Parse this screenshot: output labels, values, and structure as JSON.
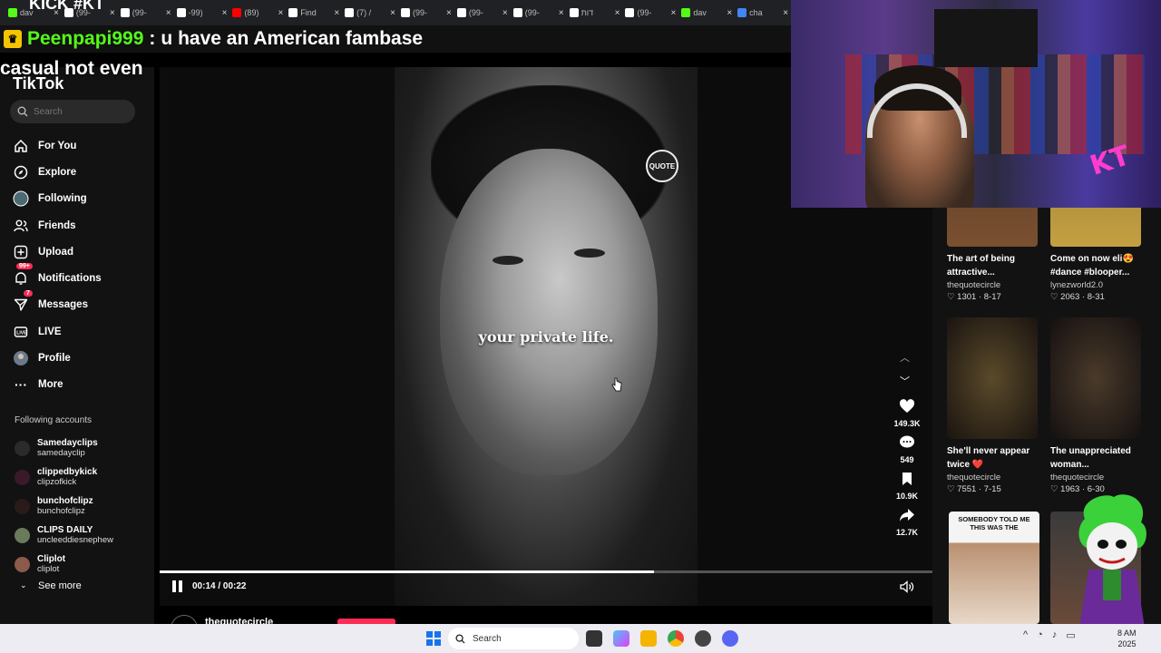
{
  "browser": {
    "tabs": [
      {
        "label": "dav",
        "icon": "kick-icon",
        "color": "#53fc18"
      },
      {
        "label": "(99-",
        "icon": "tiktok-icon",
        "color": "#ffffff"
      },
      {
        "label": "(99-",
        "icon": "tiktok-icon",
        "color": "#ffffff"
      },
      {
        "label": "-99)",
        "icon": "tiktok-icon",
        "color": "#ffffff"
      },
      {
        "label": "(89)",
        "icon": "youtube-icon",
        "color": "#ff0000"
      },
      {
        "label": "Find",
        "icon": "tiktok-icon",
        "color": "#ffffff"
      },
      {
        "label": "(7) /",
        "icon": "x-icon",
        "color": "#ffffff"
      },
      {
        "label": "(99-",
        "icon": "tiktok-icon",
        "color": "#ffffff"
      },
      {
        "label": "(99-",
        "icon": "tiktok-icon",
        "color": "#ffffff"
      },
      {
        "label": "(99-",
        "icon": "tiktok-icon",
        "color": "#ffffff"
      },
      {
        "label": "דות",
        "icon": "tiktok-icon",
        "color": "#ffffff"
      },
      {
        "label": "(99-",
        "icon": "tiktok-icon",
        "color": "#ffffff"
      },
      {
        "label": "dav",
        "icon": "kick-icon",
        "color": "#53fc18"
      },
      {
        "label": "cha",
        "icon": "chrome-icon",
        "color": "#4285f4"
      }
    ]
  },
  "stream": {
    "title": "KICK #KT",
    "chat_user": "Peenpapi999",
    "chat_separator": ":",
    "chat_message": "u have an American fambase",
    "side_caption": "casual not even"
  },
  "sidebar": {
    "logo": "TikTok",
    "search_placeholder": "Search",
    "nav": [
      {
        "label": "For You",
        "icon": "home-icon"
      },
      {
        "label": "Explore",
        "icon": "compass-icon"
      },
      {
        "label": "Following",
        "icon": "following-icon"
      },
      {
        "label": "Friends",
        "icon": "friends-icon"
      },
      {
        "label": "Upload",
        "icon": "upload-icon"
      },
      {
        "label": "Notifications",
        "icon": "bell-icon",
        "badge": "99+"
      },
      {
        "label": "Messages",
        "icon": "send-icon",
        "badge": "7"
      },
      {
        "label": "LIVE",
        "icon": "live-icon"
      },
      {
        "label": "Profile",
        "icon": "avatar-icon"
      },
      {
        "label": "More",
        "icon": "more-icon"
      }
    ],
    "following_header": "Following accounts",
    "following": [
      {
        "name": "Samedayclips",
        "handle": "samedayclip"
      },
      {
        "name": "clippedbykick",
        "handle": "clipzofkick"
      },
      {
        "name": "bunchofclipz",
        "handle": "bunchofclipz"
      },
      {
        "name": "CLIPS DAILY",
        "handle": "uncleeddiesnephew"
      },
      {
        "name": "Cliplot",
        "handle": "cliplot"
      }
    ],
    "see_more": "See more"
  },
  "video": {
    "watermark": "QUOTE",
    "caption": "your private life.",
    "current_time": "00:14",
    "duration": "00:22",
    "time_separator": " / ",
    "progress": 0.64,
    "author": "thequotecircle",
    "likes": "149.3K",
    "comments": "549",
    "saves": "10.9K",
    "shares": "12.7K"
  },
  "related": [
    {
      "title": "The art of being attractive...",
      "author": "thequotecircle",
      "likes": "1301",
      "date": "8-17"
    },
    {
      "title": "Come on now eli😍 #dance #blooper...",
      "author": "lynezworld2.0",
      "likes": "2063",
      "date": "8-31"
    },
    {
      "title": "She'll never appear twice ❤️",
      "author": "thequotecircle",
      "likes": "7551",
      "date": "7-15"
    },
    {
      "title": "The unappreciated woman...",
      "author": "thequotecircle",
      "likes": "1963",
      "date": "6-30"
    },
    {
      "title": "SOMEBODY TOLD ME THIS WAS THE",
      "author": "",
      "likes": "",
      "date": ""
    }
  ],
  "taskbar": {
    "search_placeholder": "Search",
    "time": "8 AM",
    "date": "2025"
  },
  "colors": {
    "tiktok_red": "#fe2c55",
    "kick_green": "#53fc18"
  }
}
